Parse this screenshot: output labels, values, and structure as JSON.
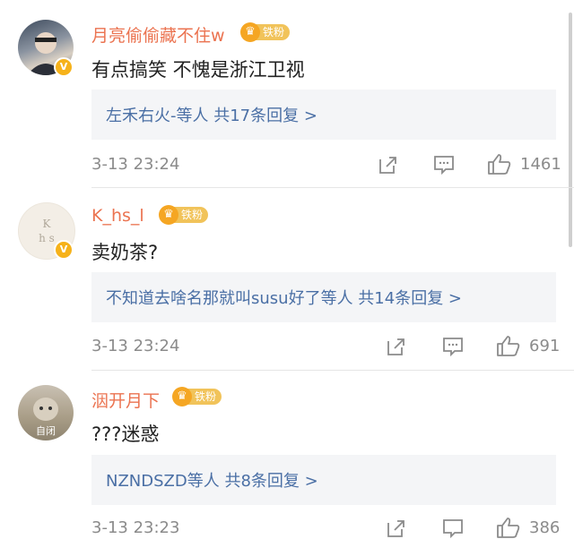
{
  "comments": [
    {
      "username": "月亮偷偷藏不住w",
      "fan_badge": "铁粉",
      "text": "有点搞笑 不愧是浙江卫视",
      "reply_summary": "左禾右火-等人 共17条回复 >",
      "timestamp": "3-13 23:24",
      "likes": "1461"
    },
    {
      "username": "K_hs_l",
      "fan_badge": "铁粉",
      "text": "卖奶茶?",
      "reply_summary": "不知道去啥名那就叫susu好了等人 共14条回复 >",
      "timestamp": "3-13 23:24",
      "likes": "691"
    },
    {
      "username": "洇开月下",
      "fan_badge": "铁粉",
      "text": "???迷惑",
      "avatar_text": "自闭",
      "reply_summary": "NZNDSZD等人 共8条回复 >",
      "timestamp": "3-13 23:23",
      "likes": "386"
    }
  ],
  "colors": {
    "username": "#eb7350",
    "reply_link": "#4a6fa5",
    "meta_gray": "#8b8b8b",
    "reply_bg": "#f4f5f7",
    "badge_gold": "#f1c35a"
  },
  "icons": [
    "verified-badge-icon",
    "crown-icon",
    "share-icon",
    "comment-icon",
    "like-icon"
  ]
}
